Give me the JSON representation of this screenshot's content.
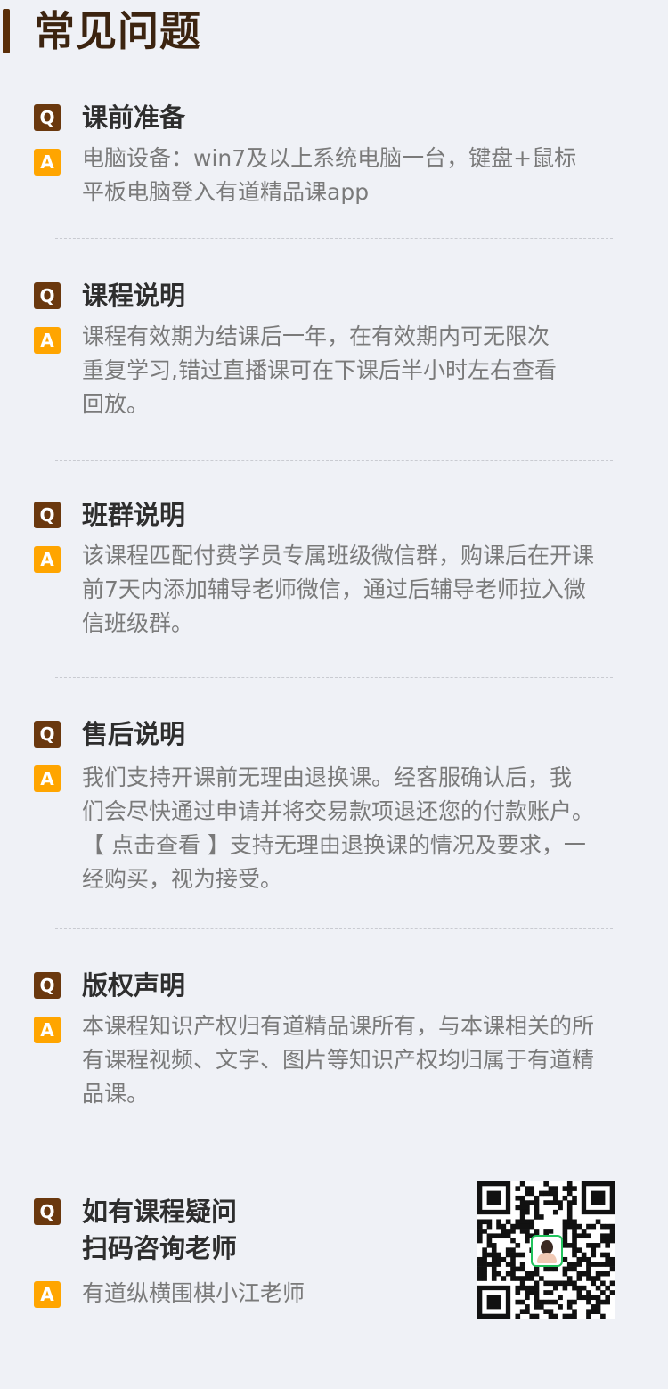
{
  "header": {
    "title": "常见问题"
  },
  "badges": {
    "q": "Q",
    "a": "A"
  },
  "faq": [
    {
      "question": "课前准备",
      "answer_lines": [
        "电脑设备：win7及以上系统电脑一台，键盘+鼠标",
        "平板电脑登入有道精品课app"
      ]
    },
    {
      "question": "课程说明",
      "answer_lines": [
        "课程有效期为结课后一年，在有效期内可无限次",
        "重复学习,错过直播课可在下课后半小时左右查看",
        "回放。"
      ]
    },
    {
      "question": "班群说明",
      "answer_lines": [
        "该课程匹配付费学员专属班级微信群，购课后在开课",
        "前7天内添加辅导老师微信，通过后辅导老师拉入微",
        "信班级群。"
      ]
    },
    {
      "question": "售后说明",
      "answer_lines": [
        "我们支持开课前无理由退换课。经客服确认后，我",
        "们会尽快通过申请并将交易款项退还您的付款账户。",
        "【 点击查看 】支持无理由退换课的情况及要求，一",
        "经购买，视为接受。"
      ]
    },
    {
      "question": "版权声明",
      "answer_lines": [
        "本课程知识产权归有道精品课所有，与本课相关的所",
        "有课程视频、文字、图片等知识产权均归属于有道精",
        "品课。"
      ]
    }
  ],
  "contact": {
    "question_lines": [
      "如有课程疑问",
      "扫码咨询老师"
    ],
    "answer": "有道纵横围棋小江老师",
    "qr_icon": "qr-code-icon"
  },
  "colors": {
    "q_badge": "#6a380e",
    "a_badge": "#ffa500",
    "background": "#eff1f6"
  }
}
